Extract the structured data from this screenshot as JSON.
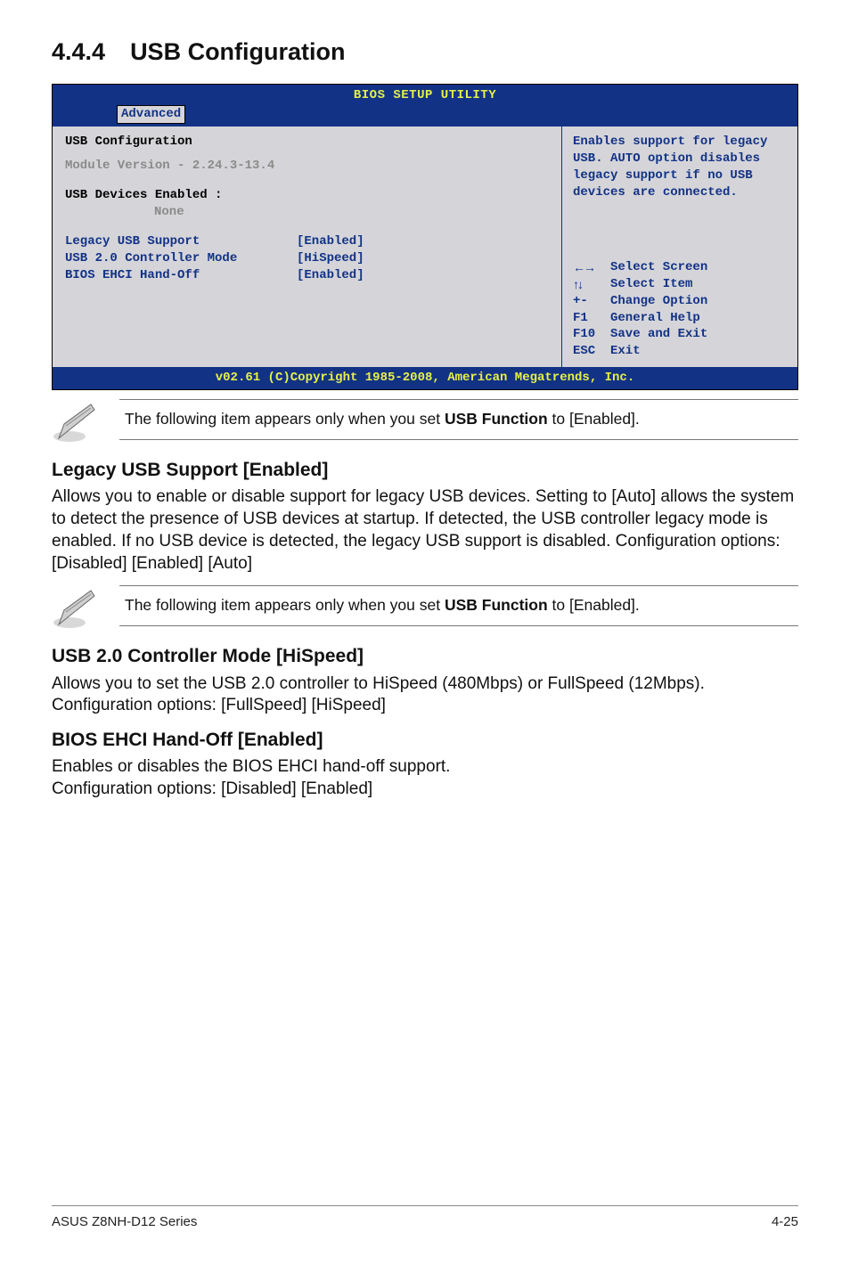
{
  "section_number": "4.4.4",
  "section_title": "USB Configuration",
  "bios": {
    "title": "BIOS SETUP UTILITY",
    "tab": "Advanced",
    "left": {
      "header": "USB Configuration",
      "module_line": "Module Version - 2.24.3-13.4",
      "dev_header": "USB Devices Enabled :",
      "dev_value": "None",
      "settings": [
        {
          "label": "Legacy USB Support",
          "value": "[Enabled]"
        },
        {
          "label": "USB 2.0 Controller Mode",
          "value": "[HiSpeed]"
        },
        {
          "label": "BIOS EHCI Hand-Off",
          "value": "[Enabled]"
        }
      ]
    },
    "help": {
      "text": "Enables support for legacy USB. AUTO option disables legacy support if no USB devices are connected.",
      "nav": [
        {
          "key": "←→",
          "label": "Select Screen"
        },
        {
          "key": "↑↓",
          "label": "Select Item"
        },
        {
          "key": "+-",
          "label": "Change Option"
        },
        {
          "key": "F1",
          "label": "General Help"
        },
        {
          "key": "F10",
          "label": "Save and Exit"
        },
        {
          "key": "ESC",
          "label": "Exit"
        }
      ]
    },
    "footer": "v02.61 (C)Copyright 1985-2008, American Megatrends, Inc."
  },
  "note1_pre": "The following item appears only when you set ",
  "note1_bold": "USB Function",
  "note1_post": " to [Enabled].",
  "option1": {
    "heading": "Legacy USB Support [Enabled]",
    "body": "Allows you to enable or disable support for legacy USB devices. Setting to [Auto] allows the system to detect the presence of USB devices at startup. If detected, the USB controller legacy mode is enabled. If no USB device is detected, the legacy USB support is disabled. Configuration options: [Disabled] [Enabled] [Auto]"
  },
  "note2_pre": "The following item appears only when you set ",
  "note2_bold": "USB Function",
  "note2_post": " to [Enabled].",
  "option2": {
    "heading": "USB 2.0 Controller Mode [HiSpeed]",
    "body": "Allows you to set the USB 2.0 controller to HiSpeed (480Mbps) or FullSpeed (12Mbps). Configuration options: [FullSpeed] [HiSpeed]"
  },
  "option3": {
    "heading": "BIOS EHCI Hand-Off [Enabled]",
    "body1": "Enables or disables the BIOS EHCI hand-off support.",
    "body2": "Configuration options: [Disabled] [Enabled]"
  },
  "footer_left": "ASUS Z8NH-D12 Series",
  "footer_right": "4-25"
}
